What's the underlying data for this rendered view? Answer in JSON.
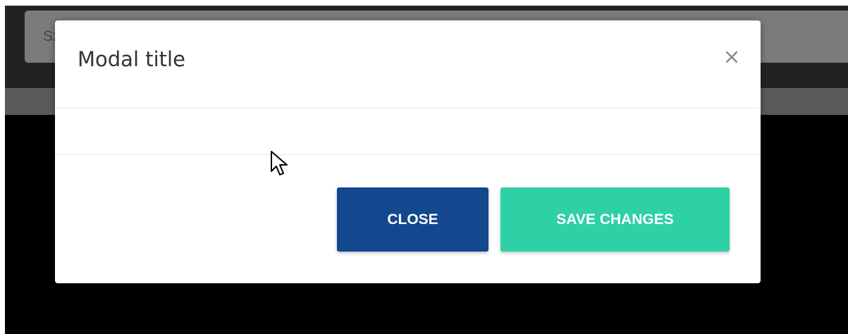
{
  "background": {
    "search": {
      "visible_text": "Sz"
    }
  },
  "modal": {
    "title": "Modal title",
    "close_icon": "close-icon",
    "body_text": "",
    "footer": {
      "close_label": "CLOSE",
      "save_label": "SAVE CHANGES"
    }
  },
  "colors": {
    "close_button": "#13478e",
    "save_button": "#2dd1a5",
    "backdrop": "#000000"
  }
}
